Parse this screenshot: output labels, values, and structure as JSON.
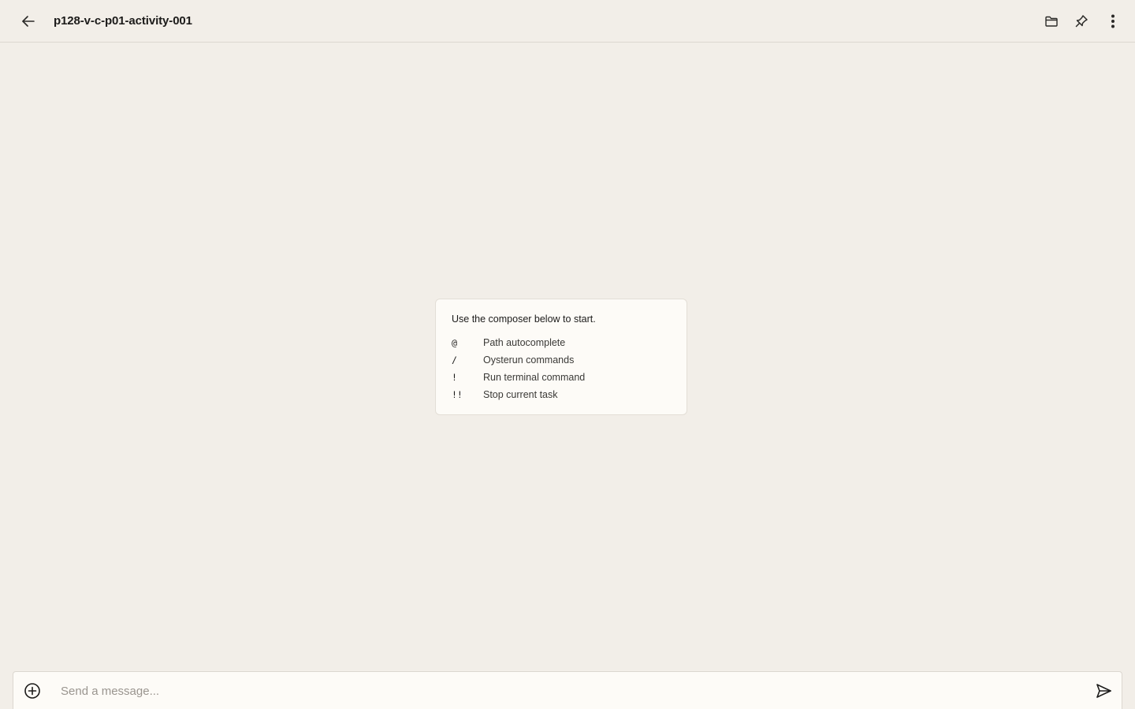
{
  "header": {
    "title": "p128-v-c-p01-activity-001",
    "back_icon": "arrow-left-icon",
    "actions": [
      "folder-icon",
      "pin-icon",
      "more-vertical-icon"
    ]
  },
  "hint_card": {
    "intro": "Use the composer below to start.",
    "shortcuts": [
      {
        "key": "@",
        "description": "Path autocomplete"
      },
      {
        "key": "/",
        "description": "Oysterun commands"
      },
      {
        "key": "!",
        "description": "Run terminal command"
      },
      {
        "key": "!!",
        "description": "Stop current task"
      }
    ]
  },
  "composer": {
    "placeholder": "Send a message...",
    "value": "",
    "attach_icon": "plus-circle-icon",
    "send_icon": "send-icon"
  },
  "colors": {
    "background": "#f2eee8",
    "card": "#fdfbf7",
    "border": "#dcd7d0",
    "text": "#1c1b1a"
  }
}
